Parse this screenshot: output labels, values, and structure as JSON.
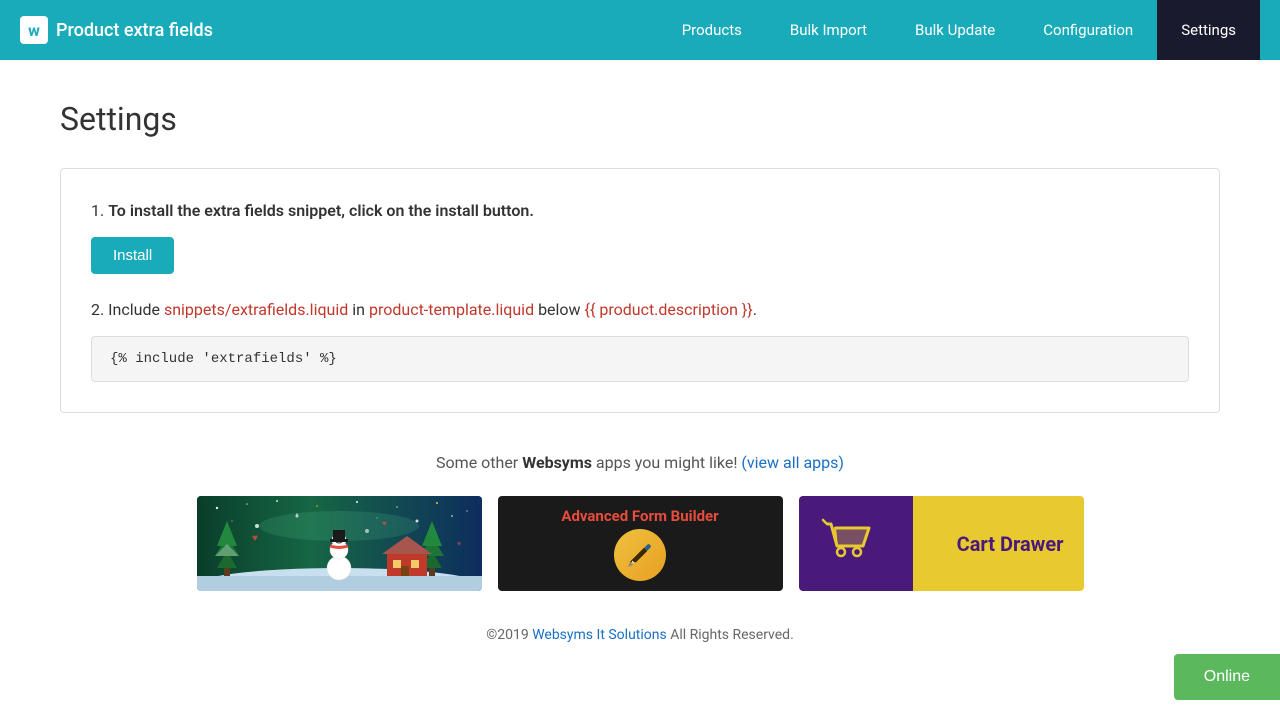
{
  "header": {
    "logo_icon": "w",
    "logo_text": "Product extra fields",
    "nav": [
      {
        "id": "products",
        "label": "Products",
        "active": false
      },
      {
        "id": "bulk-import",
        "label": "Bulk Import",
        "active": false
      },
      {
        "id": "bulk-update",
        "label": "Bulk Update",
        "active": false
      },
      {
        "id": "configuration",
        "label": "Configuration",
        "active": false
      },
      {
        "id": "settings",
        "label": "Settings",
        "active": true
      }
    ]
  },
  "page": {
    "title": "Settings"
  },
  "settings_card": {
    "step1_text_bold": "To install the extra fields snippet, click on the install button.",
    "step1_prefix": "1. ",
    "install_label": "Install",
    "step2_prefix": "2. Include ",
    "step2_file1": "snippets/extrafields.liquid",
    "step2_mid": " in ",
    "step2_file2": "product-template.liquid",
    "step2_suffix": " below ",
    "step2_code": "{{ product.description }}",
    "step2_end": ".",
    "code_snippet": "{% include 'extrafields' %}"
  },
  "apps_section": {
    "tagline_start": "Some other ",
    "brand": "Websyms",
    "tagline_mid": " apps you might like! ",
    "view_all_label": "(view all apps)",
    "view_all_href": "#",
    "apps": [
      {
        "id": "app1",
        "name": "Holiday App"
      },
      {
        "id": "app2",
        "name": "Advanced Form Builder",
        "title": "Advanced Form Builder"
      },
      {
        "id": "app3",
        "name": "Cart Drawer",
        "title": "Cart Drawer"
      }
    ]
  },
  "footer": {
    "copyright": "©2019 ",
    "company": "Websyms It Solutions",
    "suffix": " All Rights Reserved."
  },
  "online_button": {
    "label": "Online"
  }
}
